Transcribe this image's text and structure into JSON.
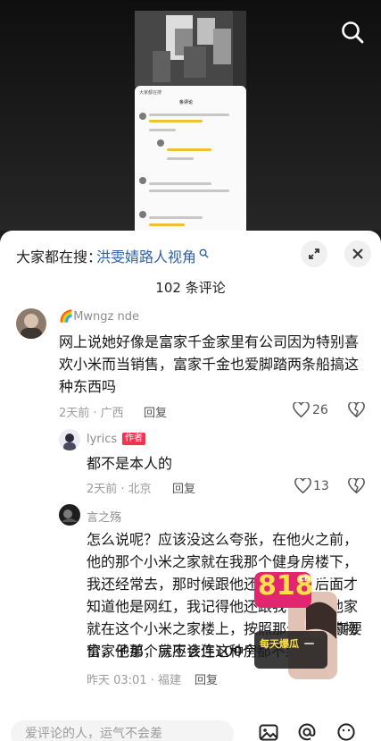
{
  "search_bar": {
    "prefix": "大家都在搜：",
    "query": "洪雯婧路人视角",
    "query_icon": "search-icon"
  },
  "comment_count_title": "102 条评论",
  "comments": [
    {
      "username": "Mwngz nde",
      "username_prefix_icon": "rainbow-emoji",
      "text": "网上说她好像是富家千金家里有公司因为特别喜欢小米而当销售，富家千金也爱脚踏两条船搞这种东西吗",
      "meta": "2天前 · 广西",
      "reply_label": "回复",
      "likes": "26"
    },
    {
      "username": "lyrics",
      "tag": "作者",
      "text": "都不是本人的",
      "meta": "2天前 · 北京",
      "reply_label": "回复",
      "likes": "13"
    },
    {
      "username": "言之殇",
      "text": "怎么说呢？应该没这么夸张，在他火之前，他的那个小米之家就在我那个健身房楼下，我还经常去，那时候跟他还蛮熟的，后面才知道他是网红，我记得他还跟我讲过，他家就在这个小米之家楼上，按照那个城市的物价，他那个房应该连100个都不到",
      "text_after_ad": "真要",
      "text_line7": "富家子弟，就不会住这种房",
      "meta": "昨天 03:01 · 福建",
      "reply_label": "回复"
    }
  ],
  "ad": {
    "brand": "818",
    "brand_sub": "chiGUA",
    "line1": "每天爆瓜",
    "line2": "一"
  },
  "input": {
    "placeholder": "爱评论的人，运气不会差"
  },
  "colors": {
    "link": "#2f5fa5",
    "author_tag": "#f2324f"
  }
}
